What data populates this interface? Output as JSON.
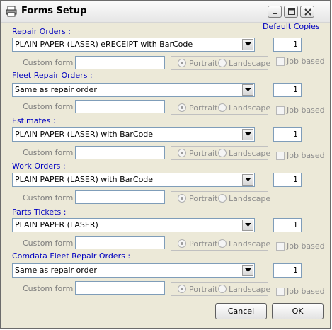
{
  "window": {
    "title": "Forms Setup",
    "icon": "printer-icon"
  },
  "header": {
    "default_copies": "Default Copies"
  },
  "sections": [
    {
      "label": "Repair Orders :",
      "form": "PLAIN PAPER (LASER) eRECEIPT with BarCode",
      "copies": "1",
      "custom_form_label": "Custom form file :",
      "custom_form_value": "",
      "portrait": "Portrait",
      "landscape": "Landscape",
      "job_based": "Job based"
    },
    {
      "label": "Fleet Repair Orders :",
      "form": "Same as repair order",
      "copies": "1",
      "custom_form_label": "Custom form file :",
      "custom_form_value": "",
      "portrait": "Portrait",
      "landscape": "Landscape",
      "job_based": "Job based"
    },
    {
      "label": "Estimates :",
      "form": "PLAIN PAPER (LASER) with BarCode",
      "copies": "1",
      "custom_form_label": "Custom form file :",
      "custom_form_value": "",
      "portrait": "Portrait",
      "landscape": "Landscape",
      "job_based": "Job based"
    },
    {
      "label": "Work Orders :",
      "form": "PLAIN PAPER (LASER) with BarCode",
      "copies": "1",
      "custom_form_label": "Custom form file :",
      "custom_form_value": "",
      "portrait": "Portrait",
      "landscape": "Landscape",
      "job_based": ""
    },
    {
      "label": "Parts Tickets :",
      "form": "PLAIN PAPER (LASER)",
      "copies": "1",
      "custom_form_label": "Custom form file :",
      "custom_form_value": "",
      "portrait": "Portrait",
      "landscape": "Landscape",
      "job_based": "Job based"
    },
    {
      "label": "Comdata Fleet Repair Orders :",
      "form": "Same as repair order",
      "copies": "1",
      "custom_form_label": "Custom form file :",
      "custom_form_value": "",
      "portrait": "Portrait",
      "landscape": "Landscape",
      "job_based": "Job based"
    }
  ],
  "buttons": {
    "cancel": "Cancel",
    "ok": "OK"
  }
}
